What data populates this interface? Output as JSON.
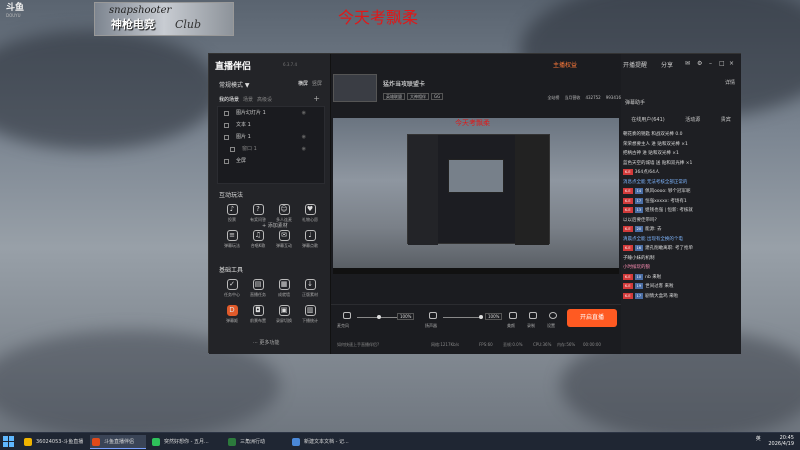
{
  "overlay": {
    "logo_main": "斗鱼",
    "logo_sub": "DOUYU",
    "banner_line1": "snapshooter",
    "banner_line2": "神枪电竞",
    "banner_line3": "Club",
    "top_title": "今天考飘柔"
  },
  "app": {
    "brand": "直播伴侣",
    "version": "6.3.7.4",
    "mode_label": "常规模式 ▼",
    "mode_tabs": [
      "横屏",
      "竖屏"
    ],
    "scene_tabs": [
      "我的场景",
      "场景",
      "高级设"
    ],
    "sources": [
      {
        "label": "图片幻灯片 1",
        "sub": false
      },
      {
        "label": "文本 1",
        "sub": false
      },
      {
        "label": "图片 1",
        "sub": false
      },
      {
        "label": "窗口 1",
        "sub": true
      },
      {
        "label": "全屏",
        "sub": false
      }
    ],
    "add_source": "+ 添加素材",
    "interact_title": "互动玩法",
    "interact_tools": [
      "投票",
      "有奖问答",
      "多人连麦",
      "礼物心愿",
      "弹幕玩法",
      "合唱K歌",
      "弹幕互动",
      "弹幕点歌"
    ],
    "basic_title": "基础工具",
    "basic_tools": [
      "任务中心",
      "直播任务",
      "成就墙",
      "正版素材",
      "弹幕姬",
      "前景布置",
      "录屏切换",
      "下播统计"
    ],
    "more_label": "··· 更多功能",
    "title_actions": [
      "主播权益",
      "开播提醒",
      "分享"
    ],
    "room_title": "猛炸当攻联盟卡",
    "game_tags": [
      "英雄联盟",
      "大神相伴",
      "GG"
    ],
    "live_stats": [
      "全站榜",
      "当月营收",
      "432752",
      "993416"
    ],
    "preview_title": "今天考飘柔",
    "mic_label": "麦克风",
    "mic_pct": "100%",
    "speaker_label": "扬声器",
    "speaker_pct": "100%",
    "ctrl_buttons": [
      "美颜",
      "录制",
      "设置"
    ],
    "live_button": "开启直播",
    "status_left": "如何快速上手直播伴侣?",
    "status_items": [
      "网络:1217Kb/s",
      "FPS:60",
      "丢帧:0.0%",
      "CPU:36%",
      "内存:56%",
      "00:00:00"
    ],
    "right_top_left": "弹幕助手",
    "right_top_right": "详情",
    "right_tabs": [
      "在线用户(641)",
      "活动源",
      "贵宾"
    ],
    "chat": [
      {
        "badge": "",
        "lv": "",
        "text": "朝花奏的钥匙 和战双光棒 0.0",
        "style": "normal"
      },
      {
        "badge": "",
        "lv": "",
        "text": "荣荣想要主人 进 贴和双光棒 ×1",
        "style": "normal"
      },
      {
        "badge": "",
        "lv": "",
        "text": "把柄古神 进 贴和双光棒 ×1",
        "style": "normal"
      },
      {
        "badge": "",
        "lv": "",
        "text": "蓝色天空的城墙 送 贴和双光棒 ×1",
        "style": "normal"
      },
      {
        "badge": "K.E",
        "lv": "",
        "text": "364点/64人",
        "style": "normal"
      },
      {
        "badge": "",
        "lv": "",
        "text": "消息点全能 无法考核全部正常的",
        "style": "blue"
      },
      {
        "badge": "K.E",
        "lv": "14",
        "text": "佩风oooo: 够个冠军呢",
        "style": "normal"
      },
      {
        "badge": "K.E",
        "lv": "17",
        "text": "恒强xxxxx: 考场有1",
        "style": "normal"
      },
      {
        "badge": "K.E",
        "lv": "13",
        "text": "姐钱也强 | 恒新: 考核就",
        "style": "normal"
      },
      {
        "badge": "",
        "lv": "",
        "text": "以以后要佳带吗?",
        "style": "normal"
      },
      {
        "badge": "K.E",
        "lv": "20",
        "text": "能源: 去",
        "style": "normal"
      },
      {
        "badge": "",
        "lv": "",
        "text": "清晨点全能 出现有全换的个电",
        "style": "blue"
      },
      {
        "badge": "K.E",
        "lv": "16",
        "text": "建孔削敢离职: 考了抢单",
        "style": "normal"
      },
      {
        "badge": "",
        "lv": "",
        "text": "子睡小妹的机制",
        "style": "normal"
      },
      {
        "badge": "",
        "lv": "",
        "text": "小时候玩的狼",
        "style": "pink"
      },
      {
        "badge": "K.E",
        "lv": "10",
        "text": "nb 来啦",
        "style": "normal"
      },
      {
        "badge": "K.E",
        "lv": "19",
        "text": "世间过客 来啦",
        "style": "normal"
      },
      {
        "badge": "K.E",
        "lv": "17",
        "text": "剧情大盒鸡 来啦",
        "style": "normal"
      }
    ]
  },
  "taskbar": {
    "items": [
      {
        "label": "36024053-斗鱼直播",
        "color": "#f0b400"
      },
      {
        "label": "斗鱼直播伴侣",
        "color": "#e04a1a"
      },
      {
        "label": "突然好想你 - 五月...",
        "color": "#2ec05a"
      },
      {
        "label": "三角洲行动",
        "color": "#2c7a3c"
      },
      {
        "label": "新建文本文档 - 记...",
        "color": "#4a88d8"
      }
    ],
    "ime": "英",
    "time": "20:45",
    "date": "2026/4/19"
  }
}
